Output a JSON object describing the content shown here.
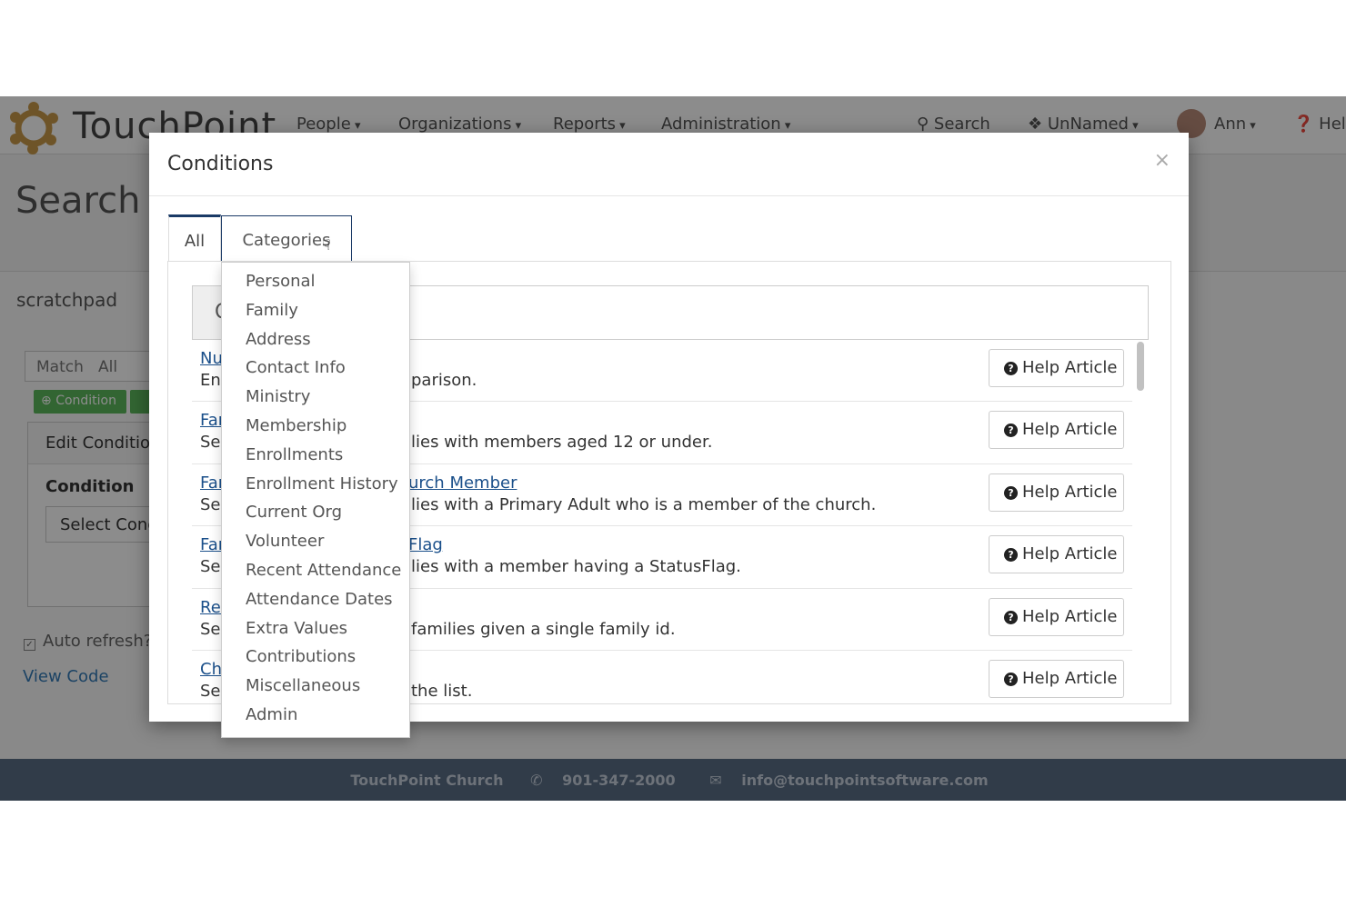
{
  "app": {
    "brand": "TouchPoint",
    "nav": {
      "people": "People",
      "organizations": "Organizations",
      "reports": "Reports",
      "administration": "Administration",
      "search": "Search",
      "tag": "UnNamed",
      "user": "Ann",
      "help": "Help"
    },
    "page_title": "Search Builder",
    "scratchpad": "scratchpad",
    "match_label": "Match",
    "match_value": "All",
    "condition_button": "Condition",
    "edit_condition": "Edit Condition",
    "condition_label": "Condition",
    "select_condition": "Select Condition",
    "auto_refresh": "Auto refresh?",
    "view_code": "View Code",
    "footer": {
      "church": "TouchPoint Church",
      "phone": "901-347-2000",
      "email": "info@touchpointsoftware.com"
    }
  },
  "modal": {
    "title": "Conditions",
    "close": "×",
    "tabs": {
      "all": "All",
      "categories": "Categories"
    },
    "search_addon": "Q",
    "rows": [
      {
        "title": "Nu",
        "desc_left": "Ent",
        "desc_right": "parison.",
        "title_right": "",
        "help": "Help Article"
      },
      {
        "title": "Far",
        "desc_left": "Sel",
        "desc_right": "lies with members aged 12 or under.",
        "title_right": "",
        "help": "Help Article"
      },
      {
        "title": "Far",
        "desc_left": "Sel",
        "desc_right": "lies with a Primary Adult who is a member of the church.",
        "title_right": "urch Member",
        "help": "Help Article"
      },
      {
        "title": "Far",
        "desc_left": "Sel",
        "desc_right": "lies with a member having a StatusFlag.",
        "title_right": "Flag",
        "help": "Help Article"
      },
      {
        "title": "Rel",
        "desc_left": "Sel",
        "desc_right": "families given a single family id.",
        "title_right": "",
        "help": "Help Article"
      },
      {
        "title": "Chu",
        "desc_left": "Sel",
        "desc_right": "the list.",
        "title_right": "",
        "help": "Help Article"
      }
    ]
  },
  "categories_menu": [
    "Personal",
    "Family",
    "Address",
    "Contact Info",
    "Ministry",
    "Membership",
    "Enrollments",
    "Enrollment History",
    "Current Org",
    "Volunteer",
    "Recent Attendance",
    "Attendance Dates",
    "Extra Values",
    "Contributions",
    "Miscellaneous",
    "Admin"
  ]
}
